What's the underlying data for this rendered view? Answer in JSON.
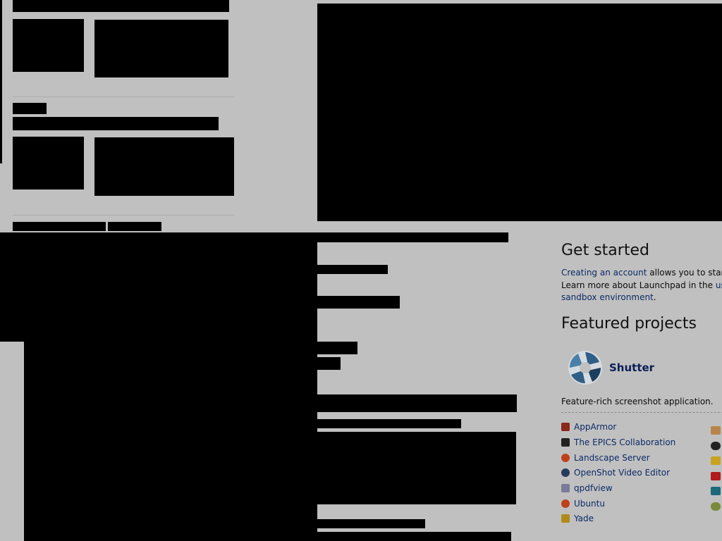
{
  "sidebar": {
    "get_started": {
      "heading": "Get started",
      "intro_link": "Creating an account",
      "intro_text": " allows you to start wo",
      "line2_text": "Learn more about Launchpad in the ",
      "line2_link": "user g",
      "line3_link": "sandbox environment",
      "line3_end": "."
    },
    "featured": {
      "heading": "Featured projects",
      "spotlight": {
        "name": "Shutter",
        "description": "Feature-rich screenshot application.",
        "icon": "shutter-logo-icon"
      },
      "projects": [
        {
          "name": "AppArmor",
          "icon": "apparmor-icon",
          "color": "#8a2a1a"
        },
        {
          "name": "The EPICS Collaboration",
          "icon": "epics-icon",
          "color": "#222222"
        },
        {
          "name": "Landscape Server",
          "icon": "landscape-icon",
          "color": "#c0401a"
        },
        {
          "name": "OpenShot Video Editor",
          "icon": "openshot-icon",
          "color": "#2a3a5a"
        },
        {
          "name": "qpdfview",
          "icon": "qpdfview-icon",
          "color": "#7a7a9a"
        },
        {
          "name": "Ubuntu",
          "icon": "ubuntu-icon",
          "color": "#c0401a"
        },
        {
          "name": "Yade",
          "icon": "yade-icon",
          "color": "#b08a1a"
        }
      ]
    }
  },
  "colors": {
    "background": "#c0c0c0",
    "link": "#0a2a66",
    "redacted": "#000000"
  }
}
